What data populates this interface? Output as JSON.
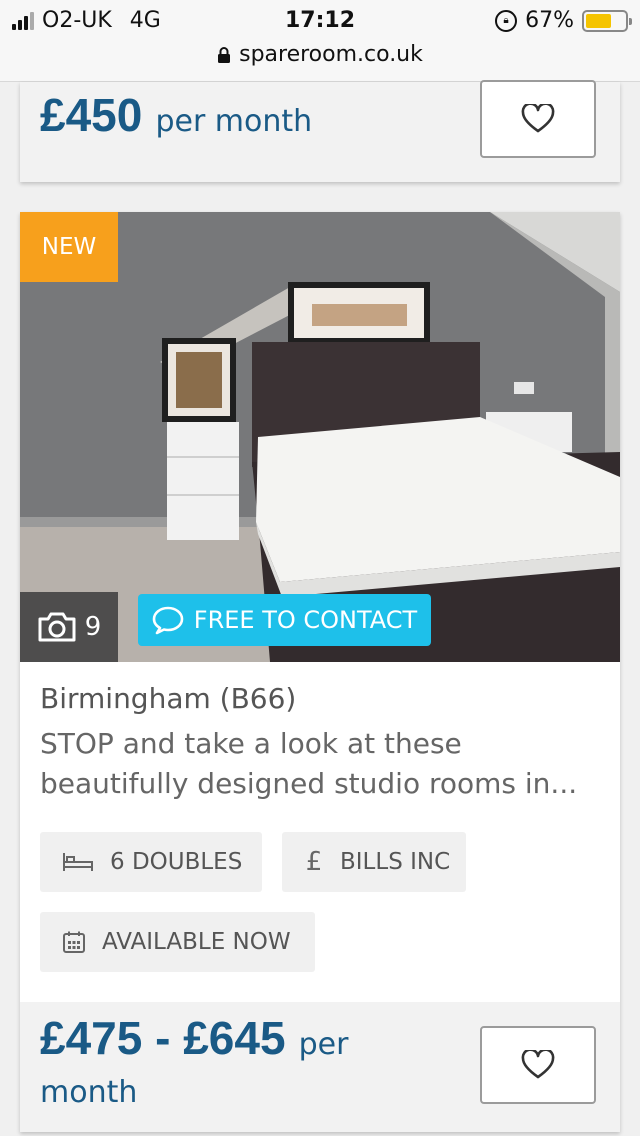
{
  "status": {
    "carrier": "O2-UK",
    "network": "4G",
    "time": "17:12",
    "battery": "67%",
    "battery_level": 0.67,
    "url": "spareroom.co.uk"
  },
  "top_listing": {
    "price": "£450",
    "period": "per month"
  },
  "listing": {
    "badge": "NEW",
    "photo_count": "9",
    "contact_label": "FREE TO CONTACT",
    "title": "Birmingham (B66)",
    "description": "STOP and take a look at these beautifully designed studio rooms in...",
    "chips": {
      "rooms": "6 DOUBLES",
      "bills": "BILLS INC",
      "availability": "AVAILABLE NOW"
    },
    "price": "£475 - £645",
    "period_a": "per",
    "period_b": "month"
  },
  "colors": {
    "brand_blue": "#1a5a86",
    "new_orange": "#f7a01c",
    "contact_cyan": "#1ec0ea"
  }
}
